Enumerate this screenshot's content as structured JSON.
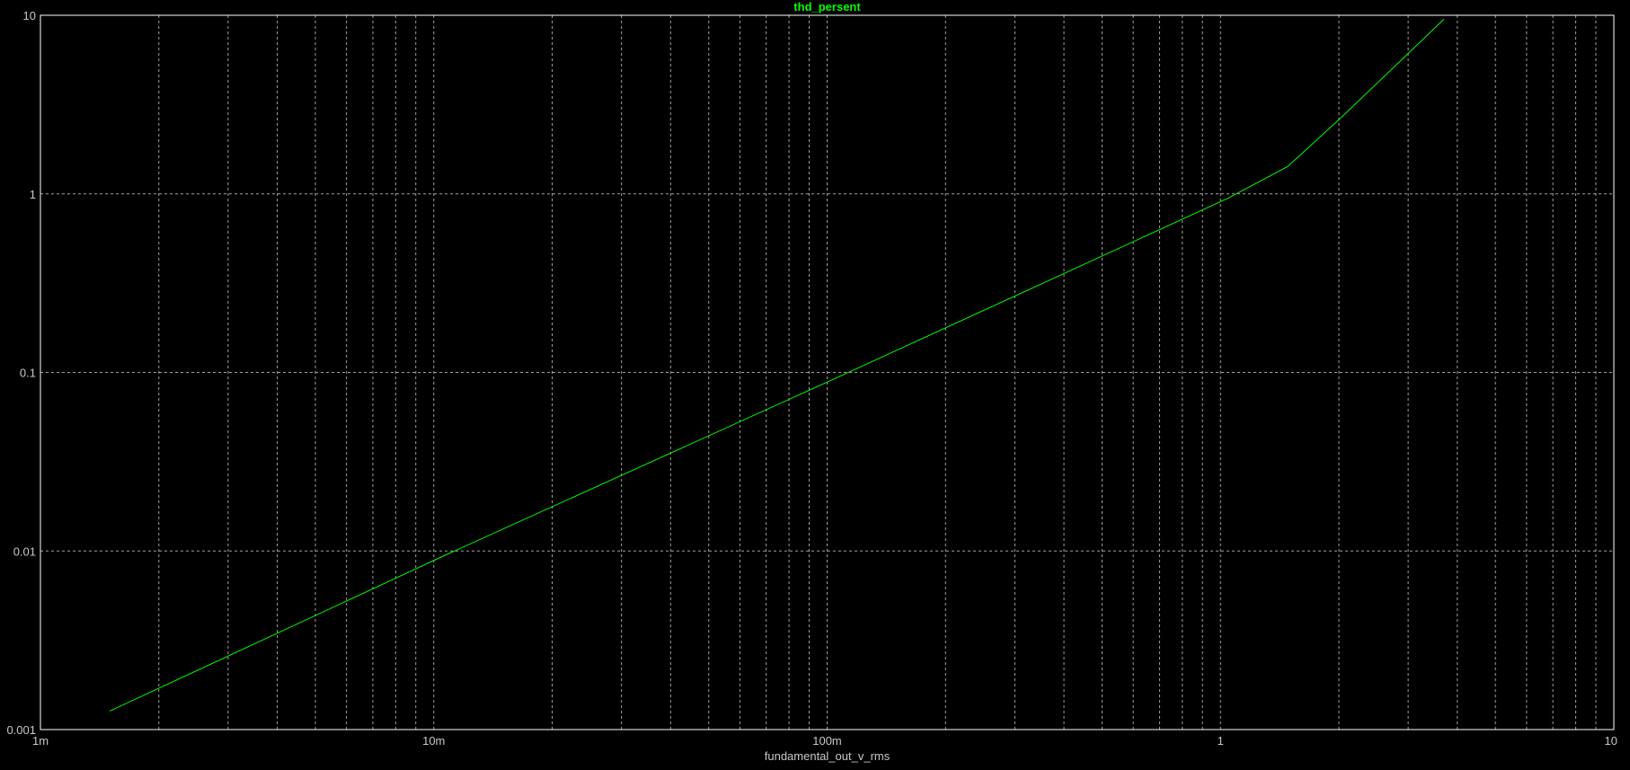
{
  "chart_data": {
    "type": "line",
    "title": "thd_persent",
    "xlabel": "fundamental_out_v_rms",
    "ylabel": "",
    "x_scale": "log",
    "y_scale": "log",
    "xlim": [
      0.001,
      10
    ],
    "ylim": [
      0.001,
      10
    ],
    "x_ticks": [
      {
        "value": 0.001,
        "label": "1m"
      },
      {
        "value": 0.01,
        "label": "10m"
      },
      {
        "value": 0.1,
        "label": "100m"
      },
      {
        "value": 1,
        "label": "1"
      },
      {
        "value": 10,
        "label": "10"
      }
    ],
    "y_ticks": [
      {
        "value": 0.001,
        "label": "0.001"
      },
      {
        "value": 0.01,
        "label": "0.01"
      },
      {
        "value": 0.1,
        "label": "0.1"
      },
      {
        "value": 1,
        "label": "1"
      },
      {
        "value": 10,
        "label": "10"
      }
    ],
    "grid": true,
    "series": [
      {
        "color": "#00ff00",
        "x": [
          0.0015,
          0.0105,
          0.11,
          1.05,
          1.48,
          2.0,
          3.7
        ],
        "y": [
          0.00127,
          0.0093,
          0.097,
          0.95,
          1.42,
          2.6,
          9.5
        ]
      }
    ]
  },
  "colors": {
    "background": "#000000",
    "frame": "#ffffff",
    "grid": "#a0a0a0",
    "text": "#c8c8c8",
    "series": "#00ff00"
  }
}
